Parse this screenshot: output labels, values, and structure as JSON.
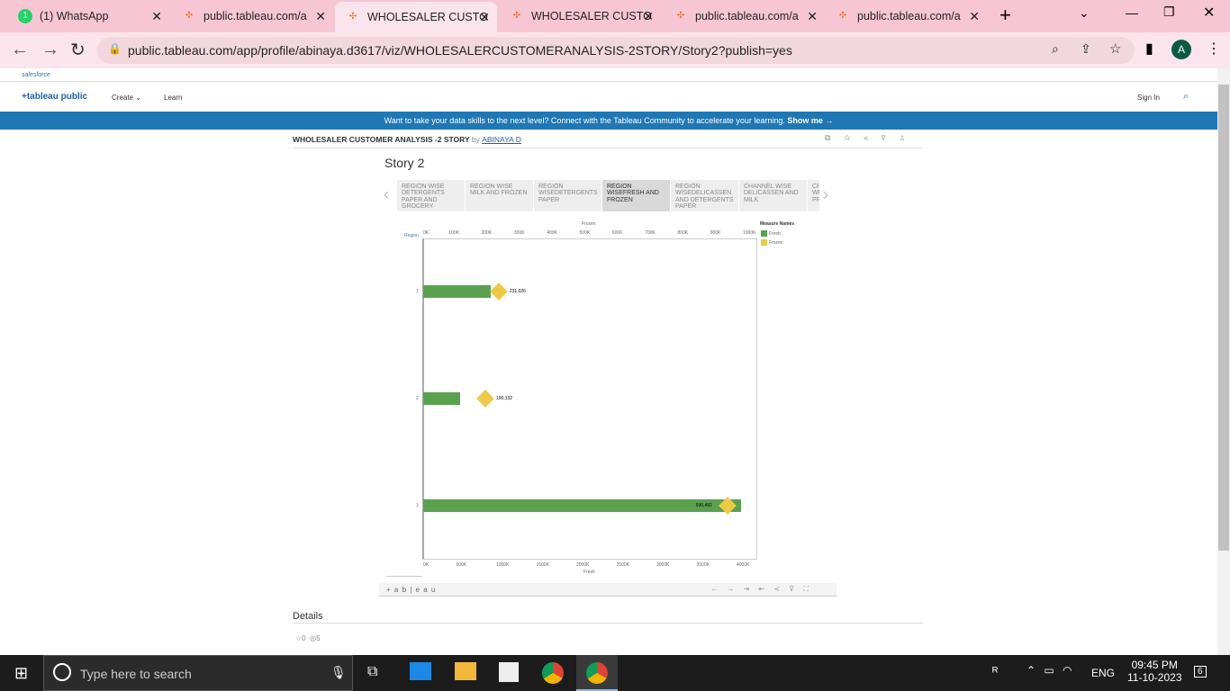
{
  "browser": {
    "tabs": [
      {
        "label": "(1) WhatsApp"
      },
      {
        "label": "public.tableau.com/a"
      },
      {
        "label": "WHOLESALER CUSTO"
      },
      {
        "label": "WHOLESALER CUSTO"
      },
      {
        "label": "public.tableau.com/a"
      },
      {
        "label": "public.tableau.com/a"
      }
    ],
    "url": "public.tableau.com/app/profile/abinaya.d3617/viz/WHOLESALERCUSTOMERANALYSIS-2STORY/Story2?publish=yes",
    "profile": "A"
  },
  "site": {
    "salesforce": "salesforce",
    "logo": "+tableau public",
    "nav": [
      "Create",
      "Learn"
    ],
    "signin": "Sign In",
    "banner": "Want to take your data skills to the next level? Connect with the Tableau Community to accelerate your learning.",
    "banner_link": "Show me →"
  },
  "viz": {
    "title": "WHOLESALER CUSTOMER ANALYSIS -2 STORY",
    "by": "by",
    "author": "ABINAYA D",
    "story_title": "Story 2",
    "story_points": [
      "REGION WISE DETERGENTS PAPER AND GROCERY",
      "REGION WISE MILK AND FROZEN",
      "REGION WISEDETERGENTS PAPER",
      "REGION WISEFRESH AND FROZEN",
      "REGION WISEDELICASSEN AND DETERGENTS PAPER",
      "CHANNEL WISE DELICASSEN AND MILK",
      "CH WI PR"
    ],
    "footer_logo": "+ a b | e a u"
  },
  "chart_data": {
    "type": "bar",
    "categories": [
      "1",
      "2",
      "3"
    ],
    "row_label": "Region",
    "series": [
      {
        "name": "Fresh",
        "axis": "bottom",
        "mark": "bar",
        "values": [
          843000,
          461000,
          3965000
        ],
        "color": "#59a14f"
      },
      {
        "name": "Frozen",
        "axis": "top",
        "mark": "diamond",
        "values": [
          231026,
          190132,
          930492
        ],
        "labels": [
          "231,026",
          "190,132",
          "930,492"
        ],
        "color": "#edc948"
      }
    ],
    "top_axis": {
      "label": "Frozen",
      "ticks": [
        "0K",
        "100K",
        "200K",
        "300K",
        "400K",
        "500K",
        "600K",
        "700K",
        "800K",
        "900K",
        "1000K"
      ],
      "range": [
        0,
        1000000
      ]
    },
    "bottom_axis": {
      "label": "Fresh",
      "ticks": [
        "0K",
        "500K",
        "1000K",
        "1500K",
        "2000K",
        "2500K",
        "3000K",
        "3500K",
        "4000K"
      ],
      "range": [
        0,
        4000000
      ]
    },
    "legend": {
      "title": "Measure Names",
      "items": [
        "Fresh",
        "Frozen"
      ],
      "placement": "right"
    }
  },
  "details": {
    "heading": "Details",
    "favorites": "0",
    "views": "5"
  },
  "taskbar": {
    "search": "Type here to search",
    "lang": "ENG",
    "time": "09:45 PM",
    "date": "11-10-2023",
    "notif": "6"
  }
}
